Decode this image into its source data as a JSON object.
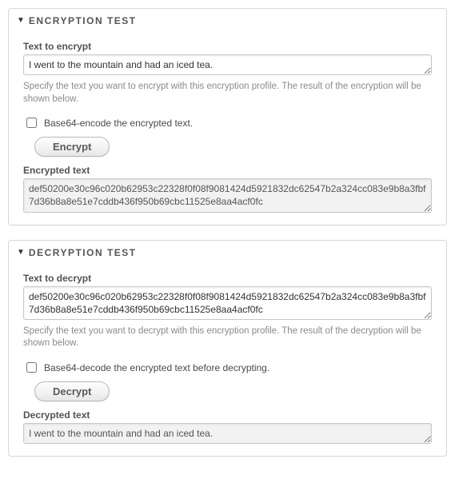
{
  "encryption": {
    "title": "ENCRYPTION TEST",
    "input_label": "Text to encrypt",
    "input_value": "I went to the mountain and had an iced tea.",
    "help": "Specify the text you want to encrypt with this encryption profile. The result of the encryption will be shown below.",
    "checkbox_label": "Base64-encode the encrypted text.",
    "button_label": "Encrypt",
    "output_label": "Encrypted text",
    "output_value": "def50200e30c96c020b62953c22328f0f08f9081424d5921832dc62547b2a324cc083e9b8a3fbf7d36b8a8e51e7cddb436f950b69cbc11525e8aa4acf0fc"
  },
  "decryption": {
    "title": "DECRYPTION TEST",
    "input_label": "Text to decrypt",
    "input_value": "def50200e30c96c020b62953c22328f0f08f9081424d5921832dc62547b2a324cc083e9b8a3fbf7d36b8a8e51e7cddb436f950b69cbc11525e8aa4acf0fc",
    "help": "Specify the text you want to decrypt with this encryption profile. The result of the decryption will be shown below.",
    "checkbox_label": "Base64-decode the encrypted text before decrypting.",
    "button_label": "Decrypt",
    "output_label": "Decrypted text",
    "output_value": "I went to the mountain and had an iced tea."
  }
}
